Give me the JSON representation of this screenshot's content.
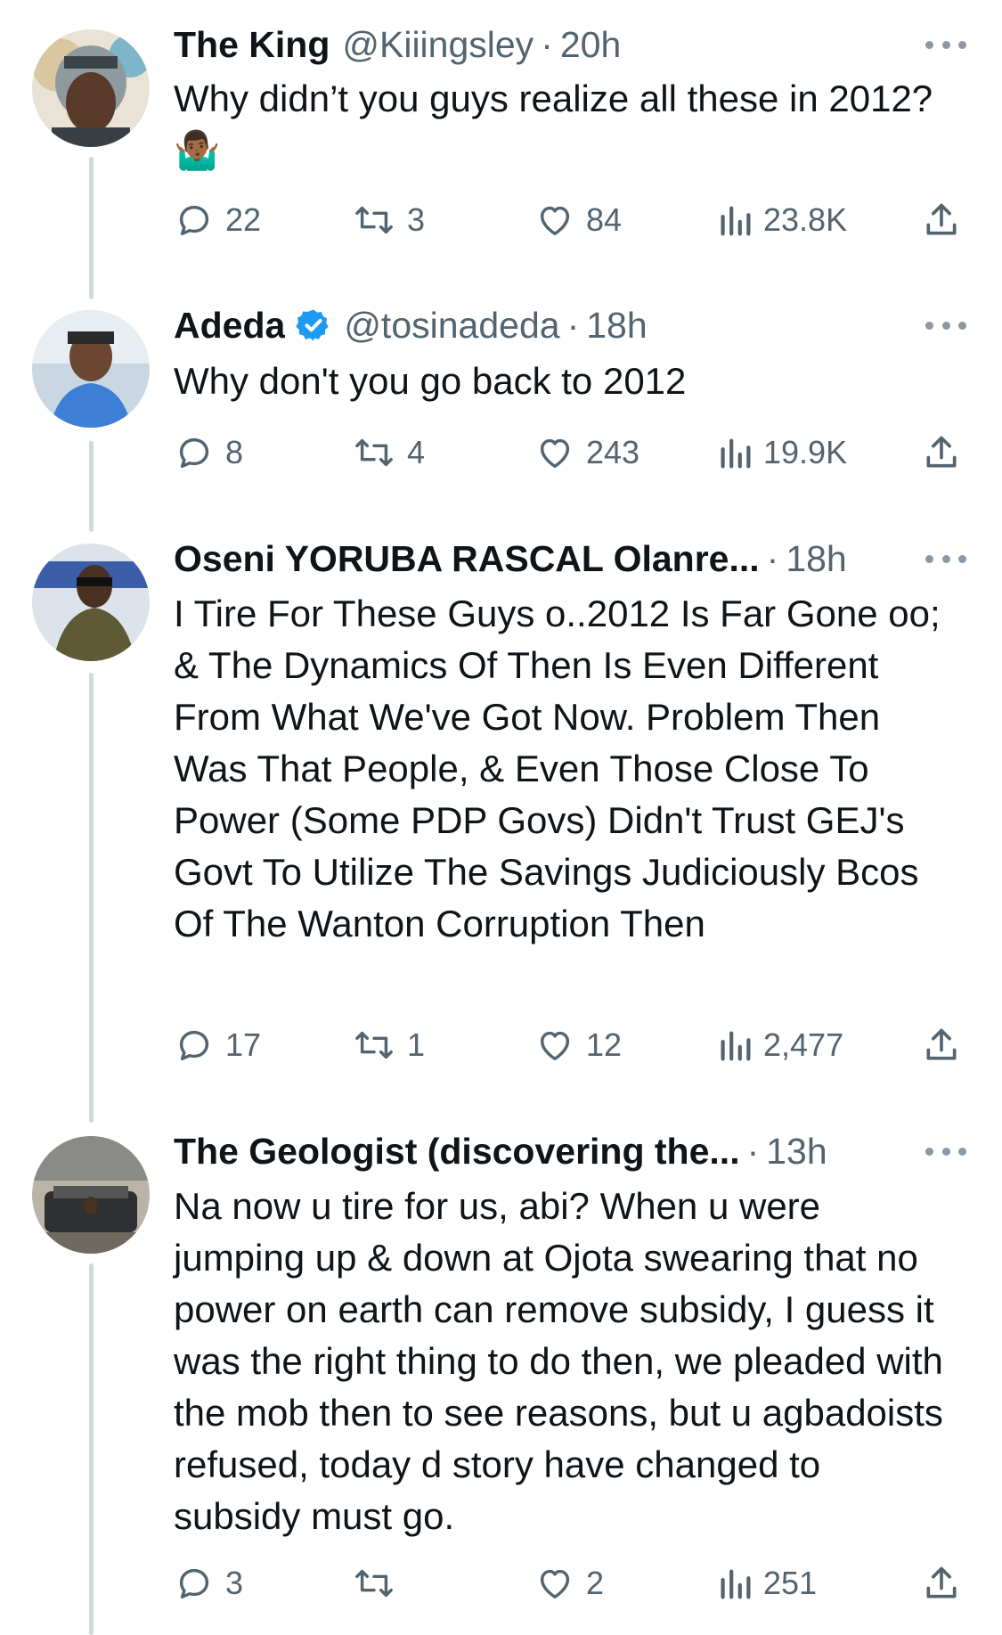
{
  "tweets": [
    {
      "name": "The King",
      "verified": false,
      "handle": "@Kiiingsley",
      "time": "20h",
      "text": "Why didn’t you guys realize all these in 2012?🤷🏾‍♂️",
      "replies": "22",
      "retweets": "3",
      "likes": "84",
      "views": "23.8K"
    },
    {
      "name": "Adeda",
      "verified": true,
      "handle": "@tosinadeda",
      "time": "18h",
      "text": "Why don't you go back to 2012",
      "replies": "8",
      "retweets": "4",
      "likes": "243",
      "views": "19.9K"
    },
    {
      "name": "Oseni YORUBA RASCAL Olanre...",
      "verified": false,
      "handle": "",
      "time": "18h",
      "text": "I Tire For These Guys o..2012 Is Far Gone oo; & The Dynamics Of Then Is Even Different From What We've Got Now. Problem Then Was That People, & Even Those Close To Power (Some PDP Govs) Didn't Trust GEJ's Govt To Utilize The Savings Judiciously Bcos Of The Wanton Corruption Then",
      "replies": "17",
      "retweets": "1",
      "likes": "12",
      "views": "2,477"
    },
    {
      "name": "The Geologist (discovering the...",
      "verified": false,
      "handle": "",
      "time": "13h",
      "text": "Na now u tire for us, abi? When u were jumping up & down at Ojota swearing that no power on earth can remove subsidy, I guess it was the right thing to do then, we pleaded with the mob then to see reasons, but u agbadoists refused, today d story have changed to subsidy must go.",
      "replies": "3",
      "retweets": "",
      "likes": "2",
      "views": "251"
    }
  ],
  "icons": [
    "reply-icon",
    "retweet-icon",
    "like-icon",
    "views-icon",
    "share-icon",
    "more-icon",
    "verified-badge-icon"
  ],
  "colors": {
    "text": "#0f1419",
    "secondary": "#536471",
    "verified": "#1d9bf0",
    "thread_line": "#cfd9de"
  }
}
